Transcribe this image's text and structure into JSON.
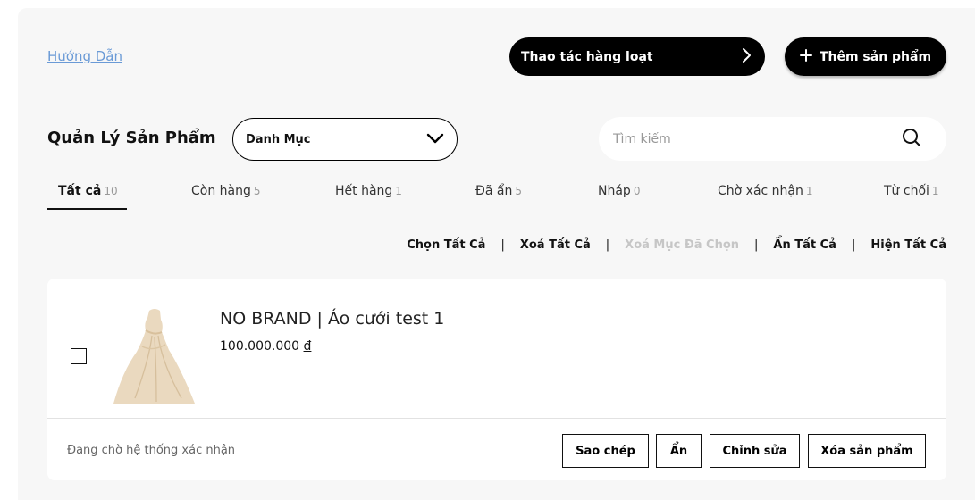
{
  "header": {
    "guide_link": "Hướng Dẫn",
    "bulk_button": "Thao tác hàng loạt",
    "add_button": "Thêm sản phẩm"
  },
  "toolbar": {
    "title": "Quản Lý Sản Phẩm",
    "category_select": "Danh Mục",
    "search_placeholder": "Tìm kiếm"
  },
  "tabs": [
    {
      "label": "Tất cả",
      "count": "10",
      "active": true
    },
    {
      "label": "Còn hàng",
      "count": "5"
    },
    {
      "label": "Hết hàng",
      "count": "1"
    },
    {
      "label": "Đã ẩn",
      "count": "5"
    },
    {
      "label": "Nháp",
      "count": "0"
    },
    {
      "label": "Chờ xác nhận",
      "count": "1"
    },
    {
      "label": "Từ chối",
      "count": "1"
    }
  ],
  "bulk_actions": {
    "select_all": "Chọn Tất Cả",
    "clear_all": "Xoá Tất Cả",
    "delete_selected": "Xoá Mục Đã Chọn",
    "hide_all": "Ẩn Tất Cả",
    "show_all": "Hiện Tất Cả",
    "separator": "|"
  },
  "product": {
    "name": "NO BRAND | Áo cưới test 1",
    "price": "100.000.000",
    "currency": "đ",
    "checked": false,
    "status": "Đang chờ hệ thống xác nhận",
    "actions": {
      "copy": "Sao chép",
      "hide": "Ẩn",
      "edit": "Chỉnh sửa",
      "delete": "Xóa sản phẩm"
    }
  },
  "colors": {
    "panel_bg": "#f7f7f7",
    "primary": "#000000",
    "link": "#6a9ad6",
    "disabled": "#c6c6c6"
  },
  "icons": {
    "bulk_arrow": "chevron-right-icon",
    "add": "plus-icon",
    "select": "chevron-down-icon",
    "search": "search-icon"
  }
}
